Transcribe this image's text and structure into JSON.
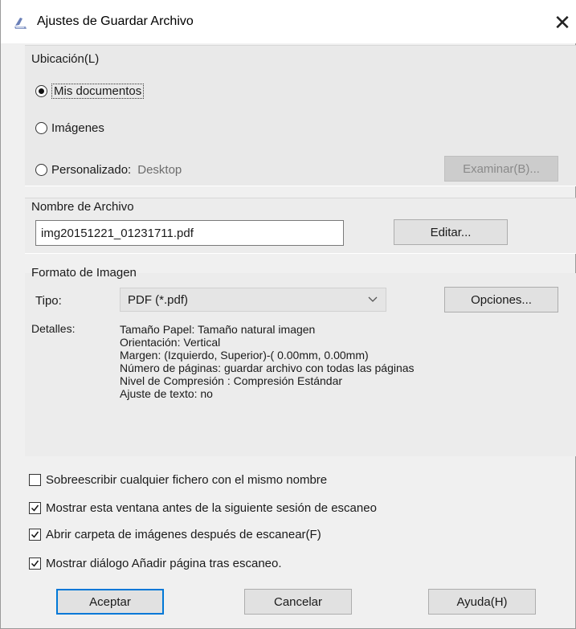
{
  "window": {
    "title": "Ajustes de Guardar Archivo",
    "close_glyph": "✕",
    "icon": "scanner-icon"
  },
  "location": {
    "label": "Ubicación(L)",
    "options": [
      {
        "label": "Mis documentos",
        "checked": true
      },
      {
        "label": "Imágenes",
        "checked": false
      },
      {
        "label": "Personalizado:",
        "checked": false,
        "value": "Desktop"
      }
    ],
    "browse_button": "Examinar(B)..."
  },
  "filename": {
    "label": "Nombre de Archivo",
    "value": "img20151221_01231711.pdf",
    "edit_button": "Editar..."
  },
  "image_format": {
    "label": "Formato de Imagen",
    "type_label": "Tipo:",
    "type_value": "PDF (*.pdf)",
    "options_button": "Opciones...",
    "details_label": "Detalles:",
    "details": [
      "Tamaño Papel: Tamaño natural imagen",
      "Orientación: Vertical",
      "Margen: (Izquierdo, Superior)-( 0.00mm, 0.00mm)",
      "Número de páginas: guardar archivo con todas las páginas",
      "Nivel de Compresión : Compresión Estándar",
      "Ajuste de texto: no"
    ]
  },
  "checkboxes": [
    {
      "label": "Sobreescribir cualquier fichero con el mismo nombre",
      "checked": false
    },
    {
      "label": "Mostrar esta ventana antes de la siguiente sesión de escaneo",
      "checked": true
    },
    {
      "label": "Abrir carpeta de imágenes después de escanear(F)",
      "checked": true
    },
    {
      "label": "Mostrar diálogo Añadir página tras escaneo.",
      "checked": true
    }
  ],
  "buttons": {
    "ok": "Aceptar",
    "cancel": "Cancelar",
    "help": "Ayuda(H)"
  },
  "colors": {
    "dialog_bg": "#f0f0f0",
    "default_button_border": "#0078d7",
    "disabled_button_bg": "#cccccc"
  }
}
